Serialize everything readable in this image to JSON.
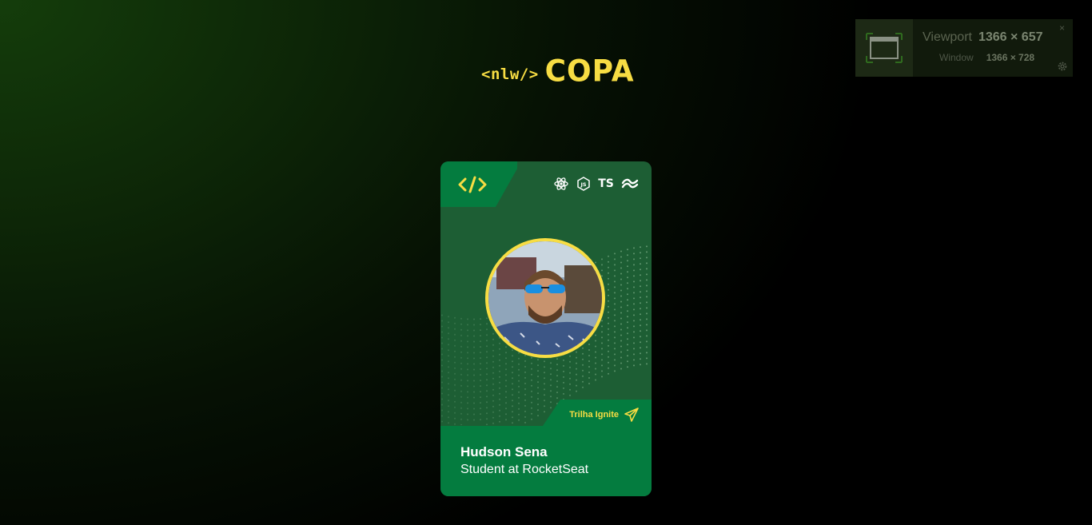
{
  "logo": {
    "prefix": "<nlw/>",
    "title": "COPA"
  },
  "viewport_overlay": {
    "viewport_label": "Viewport",
    "viewport_value": "1366 × 657",
    "window_label": "Window",
    "window_value": "1366 × 728",
    "close_glyph": "×",
    "icons": [
      "browser-window-icon",
      "gear-icon"
    ]
  },
  "badge": {
    "code_icon": "code-brackets-icon",
    "tech_icons": [
      "react-icon",
      "nodejs-icon",
      "typescript-icon",
      "tailwind-icon"
    ],
    "ts_label": "TS",
    "track_label": "Trilha Ignite",
    "track_icon": "paper-plane-icon",
    "name": "Hudson Sena",
    "role": "Student at RocketSeat"
  },
  "colors": {
    "accent_yellow": "#f7dd43",
    "badge_green": "#047c3f",
    "badge_dark_green": "#1d5e34"
  }
}
